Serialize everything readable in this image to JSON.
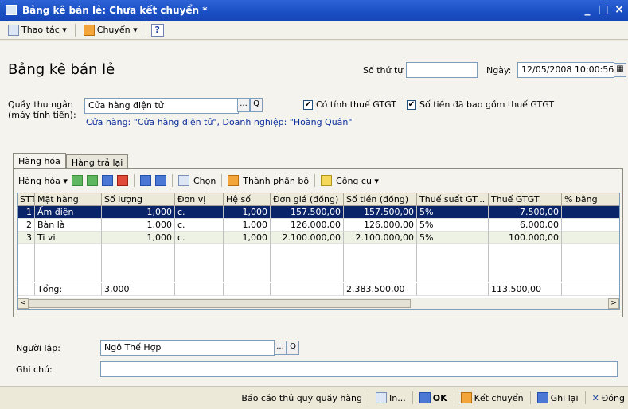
{
  "window": {
    "title": "Bảng kê bán lẻ: Chưa kết chuyển *",
    "min": "_",
    "max": "□",
    "close": "×"
  },
  "menubar": {
    "actions": "Thao tác ▾",
    "transfer": "Chuyển ▾",
    "help": "?"
  },
  "header": {
    "title": "Bảng kê bán lẻ",
    "order_label": "Số thứ tự",
    "order_value": "",
    "date_label": "Ngày:",
    "date_value": "12/05/2008 10:00:56"
  },
  "cashier": {
    "label_line1": "Quầy thu ngân",
    "label_line2": "(máy tính tiền):",
    "value": "Cửa hàng điện tử",
    "btn_more": "...",
    "btn_search": "Q",
    "info": "Cửa hàng: \"Cửa hàng điện tử\", Doanh nghiệp: \"Hoàng Quân\""
  },
  "checks": {
    "vat": {
      "label": "Có tính thuế GTGT",
      "checked": true
    },
    "incl_vat": {
      "label": "Số tiền đã bao gồm thuế GTGT",
      "checked": true
    }
  },
  "tabs": [
    {
      "label": "Hàng hóa"
    },
    {
      "label": "Hàng trả lại"
    }
  ],
  "goods_toolbar": {
    "goods": "Hàng hóa ▾",
    "select": "Chọn",
    "components": "Thành phần bộ",
    "tools": "Công cụ ▾"
  },
  "table": {
    "headers": [
      "STT",
      "Mặt hàng",
      "Số lượng",
      "Đơn vị",
      "Hệ số",
      "Đơn giá (đồng)",
      "Số tiền (đồng)",
      "Thuế suất GT...",
      "Thuế GTGT",
      "% bằng"
    ],
    "rows": [
      [
        "1",
        "Ấm điện",
        "1,000",
        "c.",
        "1,000",
        "157.500,00",
        "157.500,00",
        "5%",
        "7.500,00",
        ""
      ],
      [
        "2",
        "Bàn là",
        "1,000",
        "c.",
        "1,000",
        "126.000,00",
        "126.000,00",
        "5%",
        "6.000,00",
        ""
      ],
      [
        "3",
        "Ti vi",
        "1,000",
        "c.",
        "1,000",
        "2.100.000,00",
        "2.100.000,00",
        "5%",
        "100.000,00",
        ""
      ]
    ],
    "totals": [
      "",
      "Tổng:",
      "3,000",
      "",
      "",
      "",
      "2.383.500,00",
      "",
      "113.500,00",
      ""
    ],
    "scroll_left": "<",
    "scroll_right": ">"
  },
  "creator": {
    "label": "Người lập:",
    "value": "Ngô Thế Hợp",
    "btn_more": "...",
    "btn_search": "Q"
  },
  "note": {
    "label": "Ghi chú:",
    "value": ""
  },
  "footer": {
    "report": "Báo cáo thủ quỹ quầy hàng",
    "print": "In...",
    "ok": "OK",
    "post": "Kết chuyển",
    "save": "Ghi lại",
    "close": "Đóng"
  }
}
